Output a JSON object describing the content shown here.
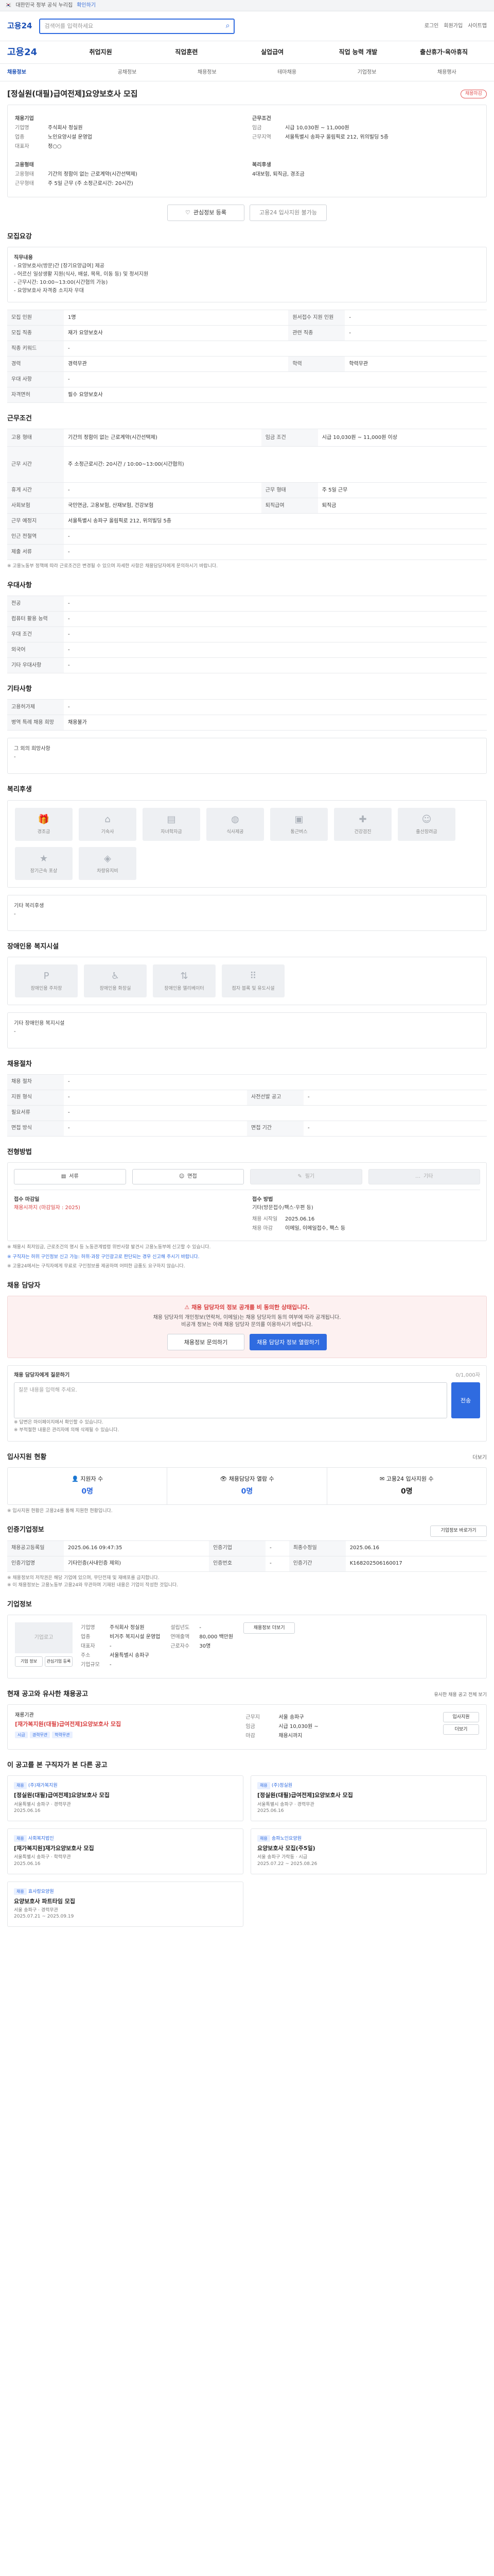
{
  "topbar": {
    "notice": "대한민국 정부 공식 누리집",
    "link": "확인하기"
  },
  "search": {
    "brand": "고용24",
    "placeholder": "검색어를 입력하세요"
  },
  "util": [
    "로그인",
    "회원가입",
    "사이트맵"
  ],
  "gnb": {
    "home": "고용24",
    "items": [
      "취업지원",
      "직업훈련",
      "실업급여",
      "직업 능력 개발",
      "출산휴가·육아휴직"
    ]
  },
  "subnav": {
    "current": "채용정보",
    "items": [
      "공채정보",
      "채용정보",
      "테마채용",
      "기업정보",
      "채용행사"
    ]
  },
  "job": {
    "title": "[정실원(대필)급여전제]요양보호사 모집",
    "badge": "채용마감",
    "company_h": "채용기업",
    "company_rows": [
      {
        "k": "기업명",
        "v": "주식회사 정실원"
      },
      {
        "k": "업종",
        "v": "노인요양시설 운영업"
      },
      {
        "k": "대표자",
        "v": "정○○"
      }
    ],
    "cond_h": "근무조건",
    "cond_rows": [
      {
        "k": "임금",
        "v": "시급 10,030원 ~ 11,000원"
      },
      {
        "k": "근무지역",
        "v": "서울특별시 송파구 올림픽로 212, 위의빌딩 5층"
      }
    ],
    "emp_h": "고용형태",
    "emp_rows": [
      {
        "k": "고용형태",
        "v": "기간의 정함이 없는 근로계약(시간선택제)"
      },
      {
        "k": "근무형태",
        "v": "주 5일 근무 (주 소정근로시간: 20시간)"
      }
    ],
    "welfare_h": "복리후생",
    "welfare_v": "4대보험, 퇴직금, 경조금",
    "btn_save": "관심정보 등록",
    "btn_apply": "고용24 입사지원 불가능"
  },
  "summary": {
    "title": "모집요강",
    "lines": [
      "직무내용",
      "- 요양보호사(방문)간 [장기요양급여] 제공",
      "- 어르신 일상생활 지원(식사, 배설, 목욕, 이동 등) 및 정서지원",
      "- 근무시간: 10:00~13:00(시간협의 가능)",
      "- 요양보호사 자격증 소지자 우대"
    ]
  },
  "recruit": {
    "rows": [
      {
        "k": "모집 인원",
        "v": "1명",
        "k2": "원서접수 지원 인원",
        "v2": "-"
      },
      {
        "k": "모집 직종",
        "v": "재가 요양보호사",
        "k2": "관련 직종",
        "v2": "-"
      },
      {
        "k": "직종 키워드",
        "v": "-",
        "k2": "",
        "v2": ""
      },
      {
        "k": "경력",
        "v": "경력무관",
        "k2": "학력",
        "v2": "학력무관"
      },
      {
        "k": "우대 사항",
        "v": "-",
        "k2": "",
        "v2": ""
      },
      {
        "k": "자격면허",
        "v": "필수 요양보호사",
        "k2": "",
        "v2": ""
      }
    ]
  },
  "workcond": {
    "title": "근무조건",
    "rows": [
      {
        "k": "고용 형태",
        "v": "기간의 정함이 없는 근로계약(시간선택제)",
        "k2": "임금 조건",
        "v2": "시급 10,030원 ~ 11,000원 이상"
      },
      {
        "k": "근무 시간",
        "v": "주 소정근로시간: 20시간 / 10:00~13:00(시간협의)",
        "k2": "",
        "v2": ""
      },
      {
        "k": "휴게 시간",
        "v": "-",
        "k2": "근무 형태",
        "v2": "주 5일 근무"
      },
      {
        "k": "사회보험",
        "v": "국민연금, 고용보험, 산재보험, 건강보험",
        "k2": "퇴직급여",
        "v2": "퇴직금"
      },
      {
        "k": "근무 예정지",
        "v": "서울특별시 송파구 올림픽로 212, 위의빌딩 5층",
        "k2": "",
        "v2": ""
      },
      {
        "k": "인근 전철역",
        "v": "-",
        "k2": "",
        "v2": ""
      },
      {
        "k": "제출 서류",
        "v": "-",
        "k2": "",
        "v2": ""
      }
    ],
    "note": "※ 고용노동부 정책에 따라 근로조건은 변경될 수 있으며 자세한 사항은 채용담당자에게 문의하시기 바랍니다."
  },
  "prefer": {
    "title": "우대사항",
    "rows": [
      {
        "k": "전공",
        "v": "-"
      },
      {
        "k": "컴퓨터 활용 능력",
        "v": "-"
      },
      {
        "k": "우대 조건",
        "v": "-"
      },
      {
        "k": "외국어",
        "v": "-"
      },
      {
        "k": "기타 우대사항",
        "v": "-"
      }
    ]
  },
  "extra": {
    "title": "기타사항",
    "rows": [
      {
        "k": "고용허가제",
        "v": "-"
      },
      {
        "k": "병역 특례 채용 희망",
        "v": "채용불가"
      }
    ],
    "etc_label": "그 외의 희망사항",
    "etc_value": "-"
  },
  "welfare": {
    "title": "복리후생",
    "items": [
      "경조금",
      "기숙사",
      "자녀학자금",
      "식사제공",
      "통근버스",
      "건강검진",
      "출산장려금",
      "장기근속 포상",
      "차량유지비"
    ],
    "other_label": "기타 복리후생",
    "other_value": "-"
  },
  "disability": {
    "title": "장애인용 복지시설",
    "items": [
      "장애인용 주차장",
      "장애인용 화장실",
      "장애인용 엘리베이터",
      "점자 블록 및 유도시설"
    ],
    "other_label": "기타 장애인용 복지시설",
    "other_value": "-"
  },
  "process": {
    "title": "채용절차",
    "rows": [
      {
        "k": "채용 절차",
        "v": "-",
        "k2": "",
        "v2": ""
      },
      {
        "k": "지원 형식",
        "v": "-",
        "k2": "사전선발 공고",
        "v2": "-"
      },
      {
        "k": "필요서류",
        "v": "-",
        "k2": "",
        "v2": ""
      },
      {
        "k": "면접 방식",
        "v": "-",
        "k2": "면접 기간",
        "v2": "-"
      }
    ]
  },
  "applyway": {
    "title": "전형방법",
    "steps": [
      "서류",
      "면접",
      "필기",
      "기타"
    ],
    "left_k": "접수 마감일",
    "left_v": "채용시까지 (마감일자 : 2025)",
    "right_k": "접수 방법",
    "right_v": "기타(방문접수/팩스·우편 등)",
    "rows": [
      {
        "k": "채용 시작일",
        "v": "2025.06.16"
      },
      {
        "k": "채용 마감",
        "v": "이메일, 이메일접수, 팩스 등"
      }
    ],
    "notes": [
      "※ 채용시 최저임금, 근로조건의 명시 등 노동관계법령 위반사항 발견시 고용노동부에 신고할 수 있습니다.",
      "※ 구직자는 허위 구인정보 신고 가능: 허위·과장 구인광고로 판단되는 경우 신고해 주시기 바랍니다.",
      "※ 고용24에서는 구직자에게 무료로 구인정보를 제공하며 어떠한 금품도 요구하지 않습니다."
    ]
  },
  "contact": {
    "title": "채용 담당자",
    "banner_h": "채용 담당자의 정보 공개를 비 동의한 상태입니다.",
    "banner_p1": "채용 담당자의 개인정보(연락처, 이메일)는 채용 담당자의 동의 여부에 따라 공개됩니다.",
    "banner_p2": "비공개 정보는 아래 채용 담당자 문의를 이용하시기 바랍니다.",
    "btn_left": "채용정보 문의하기",
    "btn_right": "채용 담당자 정보 열람하기"
  },
  "inquiry": {
    "title": "채용 담당자에게 질문하기",
    "counter": "0/1,000자",
    "placeholder": "질문 내용을 입력해 주세요.",
    "send": "전송",
    "notes": [
      "※ 답변은 마이페이지에서 확인할 수 있습니다.",
      "※ 부적절한 내용은 관리자에 의해 삭제될 수 있습니다."
    ]
  },
  "stats": {
    "title": "입사지원 현황",
    "more": "더보기",
    "items": [
      {
        "label": "지원자 수",
        "value": "0명"
      },
      {
        "label": "채용담당자 열람 수",
        "value": "0명"
      },
      {
        "label": "고용24 입사지원 수",
        "value": "0명"
      }
    ],
    "note": "※ 입사지원 현황은 고용24를 통해 지원한 현황입니다."
  },
  "info": {
    "title": "인증기업정보",
    "more": "기업정보 바로가기",
    "rows": [
      {
        "k": "채용공고등록일",
        "v": "2025.06.16 09:47:35",
        "k2": "인증기업",
        "v2": "-",
        "k3": "최종수정일",
        "v3": "2025.06.16"
      },
      {
        "k": "인증기업명",
        "v": "기타인증(사내인증 제외)",
        "k2": "인증번호",
        "v2": "-",
        "k3": "인증기간",
        "v3": "K168202506160017"
      }
    ],
    "notes": [
      "※ 채용정보의 저작권은 해당 기업에 있으며, 무단전재 및 재배포를 금지합니다.",
      "※ 이 채용정보는 고용노동부 고용24와 무관하며 기재된 내용은 기업이 작성한 것입니다."
    ]
  },
  "company": {
    "title": "기업정보",
    "logo_alt": "기업로고",
    "btn_a": "기업 정보",
    "btn_b": "관심기업 등록",
    "left": [
      {
        "k": "기업명",
        "v": "주식회사 정실원"
      },
      {
        "k": "업종",
        "v": "비거주 복지시설 운영업"
      },
      {
        "k": "대표자",
        "v": "-"
      },
      {
        "k": "주소",
        "v": "서울특별시 송파구"
      },
      {
        "k": "기업규모",
        "v": "-"
      }
    ],
    "right": [
      {
        "k": "설립년도",
        "v": "-"
      },
      {
        "k": "연매출액",
        "v": "80,000 백만원"
      },
      {
        "k": "근로자수",
        "v": "30명"
      }
    ],
    "btn_more": "채용정보 더보기"
  },
  "similar": {
    "title": "현재 공고와 유사한 채용공고",
    "more": "유사한 채용 공고 전체 보기",
    "co": "재롱기관",
    "ttl": "[재가복지원(대필)급여전제]요양보호사 모집",
    "chips": [
      "시급",
      "경력무관",
      "학력무관"
    ],
    "rows": [
      {
        "k": "근무지",
        "v": "서울 송파구"
      },
      {
        "k": "임금",
        "v": "시급 10,030원 ~"
      },
      {
        "k": "마감",
        "v": "채용시까지"
      }
    ],
    "btn_apply": "입사지원",
    "btn_more": "더보기"
  },
  "related": {
    "title": "이 공고를 본 구직자가 본 다른 공고",
    "cards": [
      {
        "label": "채용",
        "co": "(주)재가복지원",
        "ttl": "[정실원(대필)급여전제]요양보호사 모집",
        "meta": "서울특별시 송파구 · 경력무관",
        "date": "2025.06.16"
      },
      {
        "label": "채용",
        "co": "(주)정실원",
        "ttl": "[정실원(대필)급여전제]요양보호사 모집",
        "meta": "서울특별시 송파구 · 경력무관",
        "date": "2025.06.16"
      },
      {
        "label": "채용",
        "co": "사회복지법인",
        "ttl": "[재가복지원]재가요양보호사 모집",
        "meta": "서울특별시 송파구 · 학력무관",
        "date": "2025.06.16"
      },
      {
        "label": "채용",
        "co": "송파노인요양원",
        "ttl": "요양보호사 모집(주5일)",
        "meta": "서울 송파구 가락동 · 시급",
        "date": "2025.07.22 ~ 2025.08.26"
      },
      {
        "label": "채용",
        "co": "효사랑요양원",
        "ttl": "요양보호사 파트타임 모집",
        "meta": "서울 송파구 · 경력무관",
        "date": "2025.07.21 ~ 2025.09.19"
      }
    ]
  }
}
